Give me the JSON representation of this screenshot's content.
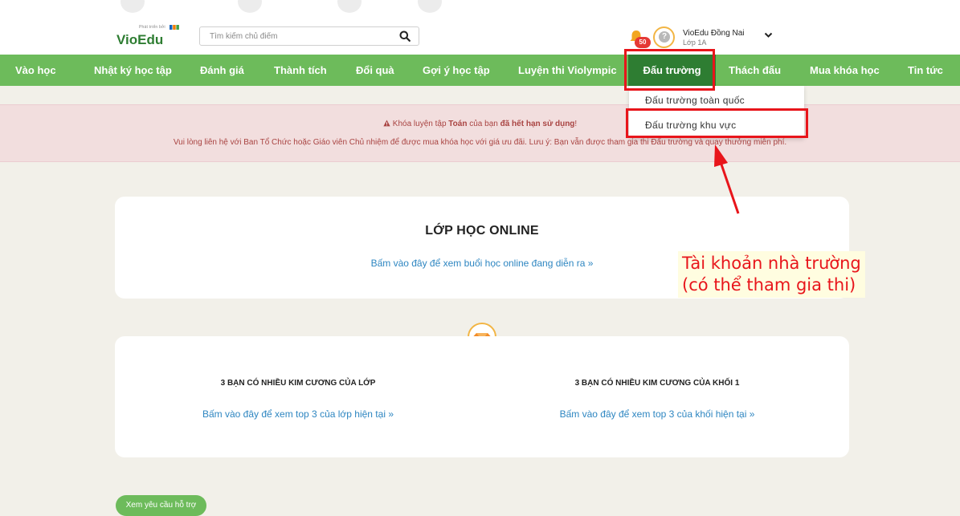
{
  "header": {
    "logo_text": "VioEdu",
    "logo_tagline": "Phát triển bởi",
    "search": {
      "placeholder": "Tìm kiếm chủ điểm"
    },
    "notification_count": "50",
    "user": {
      "name": "VioEdu Đồng Nai",
      "class": "Lớp 1A"
    }
  },
  "nav": {
    "items": [
      {
        "label": "Vào học"
      },
      {
        "label": "Nhật ký học tập"
      },
      {
        "label": "Đánh giá"
      },
      {
        "label": "Thành tích"
      },
      {
        "label": "Đổi quà"
      },
      {
        "label": "Gợi ý học tập"
      },
      {
        "label": "Luyện thi Violympic"
      },
      {
        "label": "Đấu trường"
      },
      {
        "label": "Thách đấu"
      },
      {
        "label": "Mua khóa học"
      },
      {
        "label": "Tin tức"
      }
    ],
    "active_index": 7
  },
  "dropdown": {
    "items": [
      {
        "label": "Đấu trường toàn quốc"
      },
      {
        "label": "Đấu trường khu vực"
      }
    ]
  },
  "alert": {
    "line1_pre": "Khóa luyện tập ",
    "line1_subject": "Toán",
    "line1_mid": " của bạn ",
    "line1_status": "đã hết hạn sử dụng",
    "line1_end": "!",
    "line2": "Vui lòng liên hệ với Ban Tổ Chức hoặc Giáo viên Chủ nhiệm để được mua khóa học với giá ưu đãi. Lưu ý: Bạn vẫn được tham gia thi Đấu trường và quay thưởng miễn phí."
  },
  "online_class": {
    "title": "LỚP HỌC ONLINE",
    "link": "Bấm vào đây để xem buổi học online đang diễn ra »"
  },
  "diamonds": {
    "class_title": "3 BẠN CÓ NHIỀU KIM CƯƠNG CỦA LỚP",
    "class_link": "Bấm vào đây để xem top 3 của lớp hiện tại »",
    "grade_title": "3 BẠN CÓ NHIỀU KIM CƯƠNG CỦA KHỐI 1",
    "grade_link": "Bấm vào đây để xem top 3 của khối hiện tại »"
  },
  "annotation": {
    "line1": "Tài khoản nhà trường",
    "line2": "(có thể tham gia thi)"
  },
  "support_button": "Xem yêu cầu hỗ trợ",
  "colors": {
    "nav_green": "#6dbb5b",
    "nav_active": "#2e7d32",
    "highlight_red": "#e8151b",
    "link_blue": "#2e86c1",
    "alert_bg": "#f2dede",
    "alert_text": "#a94442"
  }
}
